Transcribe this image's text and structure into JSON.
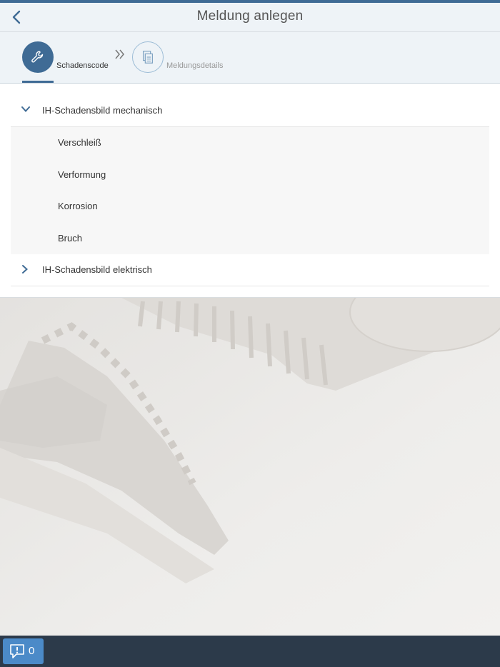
{
  "header": {
    "title": "Meldung anlegen"
  },
  "wizard": {
    "steps": [
      {
        "label": "Schadenscode",
        "active": true,
        "icon": "wrench-icon"
      },
      {
        "label": "Meldungsdetails",
        "active": false,
        "icon": "document-icon"
      }
    ]
  },
  "groups": [
    {
      "label": "IH-Schadensbild mechanisch",
      "expanded": true,
      "items": [
        "Verschleiß",
        "Verformung",
        "Korrosion",
        "Bruch"
      ]
    },
    {
      "label": "IH-Schadensbild elektrisch",
      "expanded": false,
      "items": []
    }
  ],
  "footer": {
    "message_count": "0"
  },
  "colors": {
    "accent": "#3f6b95",
    "footer": "#2c3a4a",
    "message_button": "#4b8ac8"
  }
}
